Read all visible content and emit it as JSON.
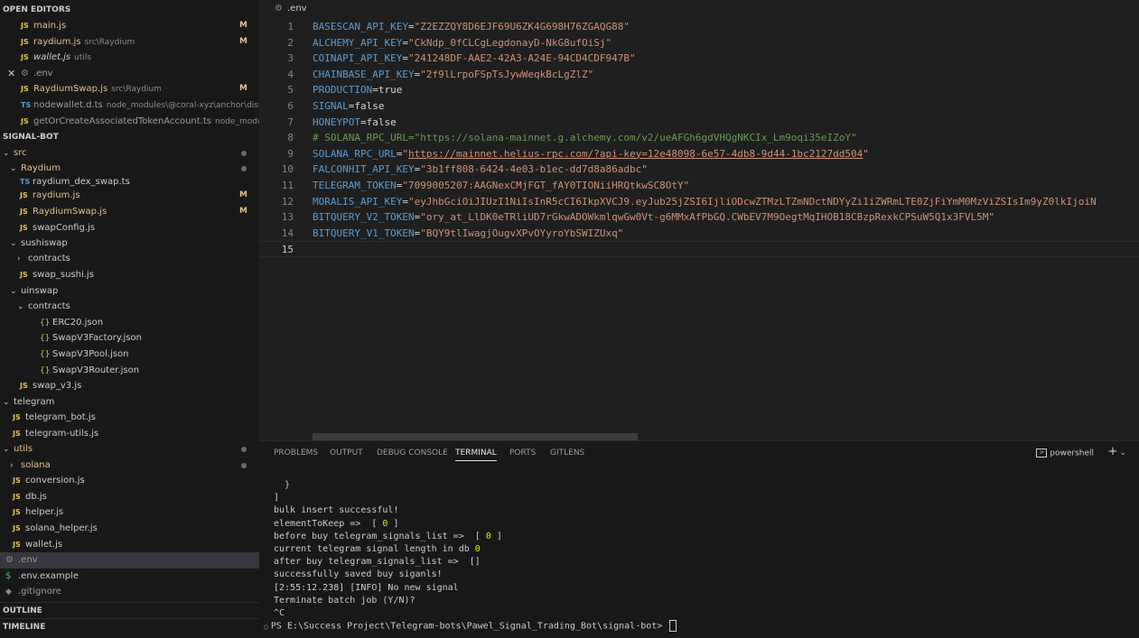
{
  "sidebar": {
    "open_editors_title": "OPEN EDITORS",
    "open_editors": [
      {
        "icon": "JS",
        "name": "main.js",
        "desc": "",
        "badge": "M"
      },
      {
        "icon": "JS",
        "name": "raydium.js",
        "desc": "src\\Raydium",
        "badge": "M"
      },
      {
        "icon": "JS",
        "name": "wallet.js",
        "desc": "utils",
        "badge": ""
      },
      {
        "icon": "⚙",
        "name": ".env",
        "desc": "",
        "badge": ""
      },
      {
        "icon": "JS",
        "name": "RaydiumSwap.js",
        "desc": "src\\Raydium",
        "badge": "M"
      },
      {
        "icon": "TS",
        "name": "nodewallet.d.ts",
        "desc": "node_modules\\@coral-xyz\\anchor\\dist\\cjs",
        "badge": ""
      },
      {
        "icon": "JS",
        "name": "getOrCreateAssociatedTokenAccount.ts",
        "desc": "node_module...",
        "badge": ""
      }
    ],
    "close_symbol": "✕",
    "project_title": "SIGNAL-BOT",
    "tree": [
      {
        "chev": "⌄",
        "icon": "",
        "name": "src",
        "dot": true,
        "badge": ""
      },
      {
        "chev": "⌄",
        "icon": "",
        "name": "Raydium",
        "dot": true,
        "badge": ""
      },
      {
        "chev": "",
        "icon": "TS",
        "name": "raydium_dex_swap.ts",
        "dot": false,
        "badge": ""
      },
      {
        "chev": "",
        "icon": "JS",
        "name": "raydium.js",
        "dot": false,
        "badge": "M"
      },
      {
        "chev": "",
        "icon": "JS",
        "name": "RaydiumSwap.js",
        "dot": false,
        "badge": "M"
      },
      {
        "chev": "",
        "icon": "JS",
        "name": "swapConfig.js",
        "dot": false,
        "badge": ""
      },
      {
        "chev": "⌄",
        "icon": "",
        "name": "sushiswap",
        "dot": false,
        "badge": ""
      },
      {
        "chev": "›",
        "icon": "",
        "name": "contracts",
        "dot": false,
        "badge": ""
      },
      {
        "chev": "",
        "icon": "JS",
        "name": "swap_sushi.js",
        "dot": false,
        "badge": ""
      },
      {
        "chev": "⌄",
        "icon": "",
        "name": "uinswap",
        "dot": false,
        "badge": ""
      },
      {
        "chev": "⌄",
        "icon": "",
        "name": "contracts",
        "dot": false,
        "badge": ""
      },
      {
        "chev": "",
        "icon": "{}",
        "name": "ERC20.json",
        "dot": false,
        "badge": ""
      },
      {
        "chev": "",
        "icon": "{}",
        "name": "SwapV3Factory.json",
        "dot": false,
        "badge": ""
      },
      {
        "chev": "",
        "icon": "{}",
        "name": "SwapV3Pool.json",
        "dot": false,
        "badge": ""
      },
      {
        "chev": "",
        "icon": "{}",
        "name": "SwapV3Router.json",
        "dot": false,
        "badge": ""
      },
      {
        "chev": "",
        "icon": "JS",
        "name": "swap_v3.js",
        "dot": false,
        "badge": ""
      },
      {
        "chev": "⌄",
        "icon": "",
        "name": "telegram",
        "dot": false,
        "badge": ""
      },
      {
        "chev": "",
        "icon": "JS",
        "name": "telegram_bot.js",
        "dot": false,
        "badge": ""
      },
      {
        "chev": "",
        "icon": "JS",
        "name": "telegram-utils.js",
        "dot": false,
        "badge": ""
      },
      {
        "chev": "⌄",
        "icon": "",
        "name": "utils",
        "dot": true,
        "badge": ""
      },
      {
        "chev": "›",
        "icon": "",
        "name": "solana",
        "dot": true,
        "badge": ""
      },
      {
        "chev": "",
        "icon": "JS",
        "name": "conversion.js",
        "dot": false,
        "badge": ""
      },
      {
        "chev": "",
        "icon": "JS",
        "name": "db.js",
        "dot": false,
        "badge": ""
      },
      {
        "chev": "",
        "icon": "JS",
        "name": "helper.js",
        "dot": false,
        "badge": ""
      },
      {
        "chev": "",
        "icon": "JS",
        "name": "solana_helper.js",
        "dot": false,
        "badge": ""
      },
      {
        "chev": "",
        "icon": "JS",
        "name": "wallet.js",
        "dot": false,
        "badge": ""
      },
      {
        "chev": "",
        "icon": "⚙",
        "name": ".env",
        "dot": false,
        "badge": ""
      },
      {
        "chev": "",
        "icon": "$",
        "name": ".env.example",
        "dot": false,
        "badge": ""
      },
      {
        "chev": "",
        "icon": "◆",
        "name": ".gitignore",
        "dot": false,
        "badge": ""
      }
    ],
    "outline_title": "OUTLINE",
    "timeline_title": "TIMELINE"
  },
  "editor": {
    "tab_icon": "⚙",
    "tab_label": ".env",
    "lines": [
      {
        "n": "1",
        "key": "BASESCAN_API_KEY",
        "val": "\"Z2EZZQY8D6EJF69U6ZK4G698H76ZGAQG88\"",
        "comment": "",
        "url": ""
      },
      {
        "n": "2",
        "key": "ALCHEMY_API_KEY",
        "val": "\"CkNdp_0fCLCgLegdonayD-NkG8ufOiSj\"",
        "comment": "",
        "url": ""
      },
      {
        "n": "3",
        "key": "COINAPI_API_KEY",
        "val": "\"241248DF-AAE2-42A3-A24E-94CD4CDF947B\"",
        "comment": "",
        "url": ""
      },
      {
        "n": "4",
        "key": "CHAINBASE_API_KEY",
        "val": "\"2f9lLrpoFSpTsJywWeqkBcLgZlZ\"",
        "comment": "",
        "url": ""
      },
      {
        "n": "5",
        "key": "PRODUCTION",
        "val": "true",
        "plain": true,
        "comment": "",
        "url": ""
      },
      {
        "n": "6",
        "key": "SIGNAL",
        "val": "false",
        "plain": true,
        "comment": "",
        "url": ""
      },
      {
        "n": "7",
        "key": "HONEYPOT",
        "val": "false",
        "plain": true,
        "comment": "",
        "url": ""
      },
      {
        "n": "8",
        "key": "",
        "val": "",
        "comment": "# SOLANA_RPC_URL=\"https://solana-mainnet.g.alchemy.com/v2/ueAFGh6gdVHQgNKCIx_Lm9oqi35eIZoY\"",
        "url": ""
      },
      {
        "n": "9",
        "key": "SOLANA_RPC_URL",
        "val": "",
        "comment": "",
        "url": "https://mainnet.helius-rpc.com/?api-key=12e48098-6e57-4db8-9d44-1bc2127dd504"
      },
      {
        "n": "10",
        "key": "FALCONHIT_API_KEY",
        "val": "\"3b1ff808-6424-4e03-b1ec-dd7d8a86adbc\"",
        "comment": "",
        "url": ""
      },
      {
        "n": "11",
        "key": "TELEGRAM_TOKEN",
        "val": "\"7099005207:AAGNexCMjFGT_fAY0TIONiiHRQtkwSC8OtY\"",
        "comment": "",
        "url": ""
      },
      {
        "n": "12",
        "key": "MORALIS_API_KEY",
        "val": "\"eyJhbGciOiJIUzI1NiIsInR5cCI6IkpXVCJ9.eyJub25jZSI6IjliODcwZTMzLTZmNDctNDYyZi1iZWRmLTE0ZjFiYmM0MzViZSIsIm9yZ0lkIjoiN",
        "comment": "",
        "url": ""
      },
      {
        "n": "13",
        "key": "BITQUERY_V2_TOKEN",
        "val": "\"ory_at_LlDK0eTRliUD7rGkwADOWkmlqwGw0Vt-g6MMxAfPbGQ.CWbEV7M9OegtMqIHOB18CBzpRexkCPSuW5Q1x3FVL5M\"",
        "comment": "",
        "url": ""
      },
      {
        "n": "14",
        "key": "BITQUERY_V1_TOKEN",
        "val": "\"BQY9tlIwagjOugvXPvOYyroYbSWIZUxq\"",
        "comment": "",
        "url": ""
      },
      {
        "n": "15",
        "key": "",
        "val": "",
        "comment": "",
        "url": ""
      }
    ]
  },
  "panel": {
    "tabs": [
      "PROBLEMS",
      "OUTPUT",
      "DEBUG CONSOLE",
      "TERMINAL",
      "PORTS",
      "GITLENS"
    ],
    "active_tab": "TERMINAL",
    "shell_label": "powershell",
    "add_symbol": "+",
    "dropdown_symbol": "⌄",
    "terminal_lines": [
      "  }",
      "]",
      "bulk insert successful!",
      "elementToKeep =>  [ 0 ]",
      "before buy telegram_signals_list =>  [ 0 ]",
      "current telegram signal length in db 0",
      "after buy telegram_signals_list =>  []",
      "successfully saved buy siganls!",
      "[2:55:12.238] [INFO] No new signal",
      "Terminate batch job (Y/N)?",
      "^C"
    ],
    "prompt": "PS E:\\Success Project\\Telegram-bots\\Pawel_Signal_Trading_Bot\\signal-bot> "
  }
}
